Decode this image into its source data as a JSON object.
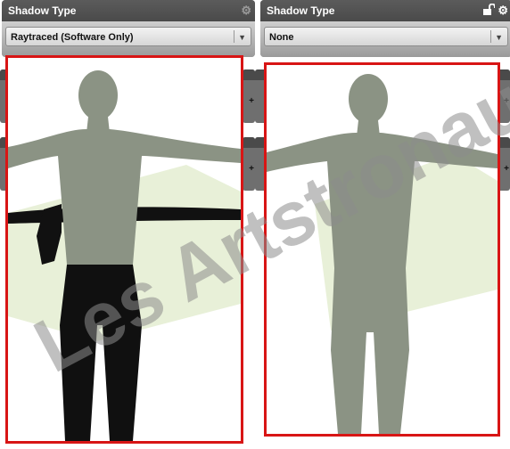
{
  "panels": [
    {
      "title": "Shadow Type",
      "selected": "Raytraced (Software Only)"
    },
    {
      "title": "Shadow Type",
      "selected": "None"
    }
  ],
  "icons": {
    "settings": "gear-icon",
    "lock": "lock-icon",
    "dropdown": "chevron-down-icon",
    "add": "plus-icon"
  },
  "watermark": "Les Artstronautes",
  "colors": {
    "highlight_border": "#d81515",
    "ground_plane": "#e8f0d8",
    "figure_skin": "#8b9384",
    "panel_header": "#4a4a4a"
  }
}
